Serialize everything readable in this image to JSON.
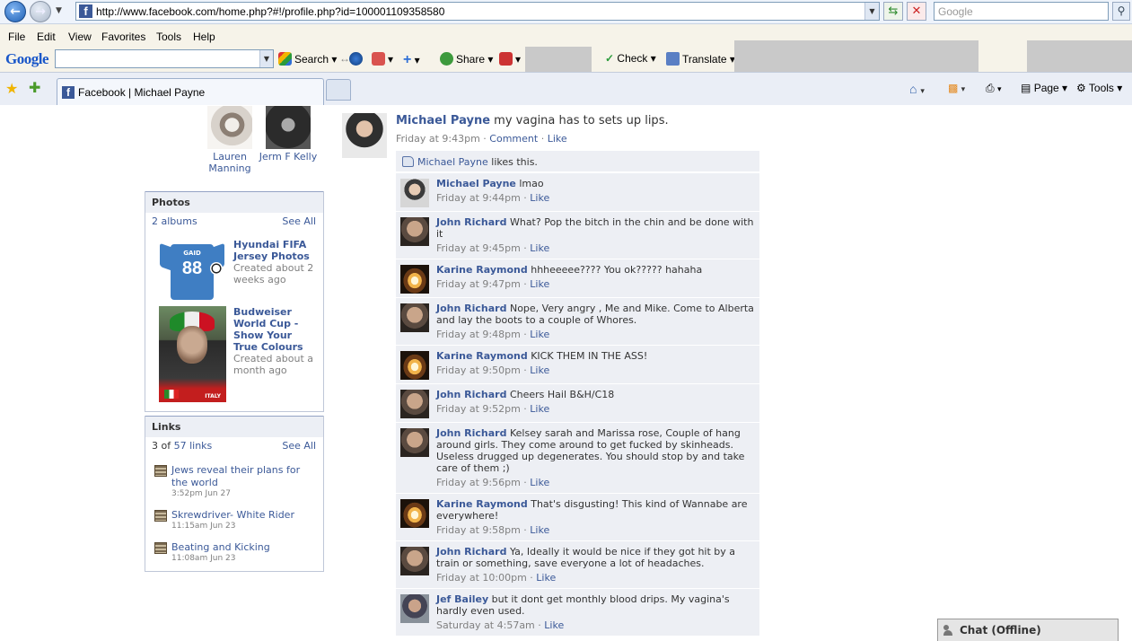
{
  "browser": {
    "url": "http://www.facebook.com/home.php?#!/profile.php?id=100001109358580",
    "search_placeholder": "Google",
    "menu": [
      "File",
      "Edit",
      "View",
      "Favorites",
      "Tools",
      "Help"
    ],
    "toolbar": {
      "logo": "Google",
      "search_label": "Search",
      "share_label": "Share",
      "check_label": "Check",
      "translate_label": "Translate"
    },
    "tab_title": "Facebook | Michael Payne",
    "commands": {
      "page": "Page",
      "tools": "Tools"
    }
  },
  "friends": [
    {
      "name": "Lauren Manning"
    },
    {
      "name": "Jerm F Kelly"
    }
  ],
  "photos": {
    "heading": "Photos",
    "count": "2 albums",
    "see_all": "See All",
    "albums": [
      {
        "title": "Hyundai FIFA Jersey Photos",
        "meta": "Created about 2 weeks ago",
        "jersey_name": "GAID",
        "jersey_number": "88"
      },
      {
        "title": "Budweiser World Cup - Show Your True Colours",
        "meta": "Created about a month ago",
        "caption": "ITALY"
      }
    ]
  },
  "links": {
    "heading": "Links",
    "count_prefix": "3 of ",
    "count_link": "57 links",
    "see_all": "See All",
    "items": [
      {
        "title": "Jews reveal their plans for the world",
        "date": "3:52pm Jun 27"
      },
      {
        "title": "Skrewdriver- White Rider",
        "date": "11:15am Jun 23"
      },
      {
        "title": "Beating and Kicking",
        "date": "11:08am Jun 23"
      }
    ]
  },
  "story": {
    "author": "Michael Payne",
    "text": "my vagina has to sets up lips.",
    "time": "Friday at 9:43pm",
    "comment_label": "Comment",
    "like_label": "Like",
    "likes_name": "Michael Payne",
    "likes_suffix": "likes this."
  },
  "comments": [
    {
      "author": "Michael Payne",
      "text": "lmao",
      "time": "Friday at 9:44pm",
      "like": "Like",
      "avatar": "mp"
    },
    {
      "author": "John Richard",
      "text": "What? Pop the bitch in the chin and be done with it",
      "time": "Friday at 9:45pm",
      "like": "Like",
      "avatar": "dark"
    },
    {
      "author": "Karine Raymond",
      "text": "hhheeeee???? You ok????? hahaha",
      "time": "Friday at 9:47pm",
      "like": "Like",
      "avatar": "fire"
    },
    {
      "author": "John Richard",
      "text": "Nope, Very angry , Me and Mike. Come to Alberta and lay the boots to a couple of Whores.",
      "time": "Friday at 9:48pm",
      "like": "Like",
      "avatar": "dark"
    },
    {
      "author": "Karine Raymond",
      "text": "KICK THEM IN THE ASS!",
      "time": "Friday at 9:50pm",
      "like": "Like",
      "avatar": "fire"
    },
    {
      "author": "John Richard",
      "text": "Cheers Hail B&H/C18",
      "time": "Friday at 9:52pm",
      "like": "Like",
      "avatar": "dark"
    },
    {
      "author": "John Richard",
      "text": "Kelsey sarah and Marissa rose, Couple of hang around girls. They come around to get fucked by skinheads. Useless drugged up degenerates. You should stop by and take care of them ;)",
      "time": "Friday at 9:56pm",
      "like": "Like",
      "avatar": "dark"
    },
    {
      "author": "Karine Raymond",
      "text": "That's disgusting! This kind of Wannabe are everywhere!",
      "time": "Friday at 9:58pm",
      "like": "Like",
      "avatar": "fire"
    },
    {
      "author": "John Richard",
      "text": "Ya, Ideally it would be nice if they got hit by a train or something, save everyone a lot of headaches.",
      "time": "Friday at 10:00pm",
      "like": "Like",
      "avatar": "dark"
    },
    {
      "author": "Jef Bailey",
      "text": "but it dont get monthly blood drips. My vagina's hardly even used.",
      "time": "Saturday at 4:57am",
      "like": "Like",
      "avatar": "jef"
    }
  ],
  "chat": {
    "label": "Chat (Offline)"
  },
  "colors": {
    "fb_link": "#3b5998",
    "comment_bg": "#edeff4",
    "meta": "#808080"
  }
}
